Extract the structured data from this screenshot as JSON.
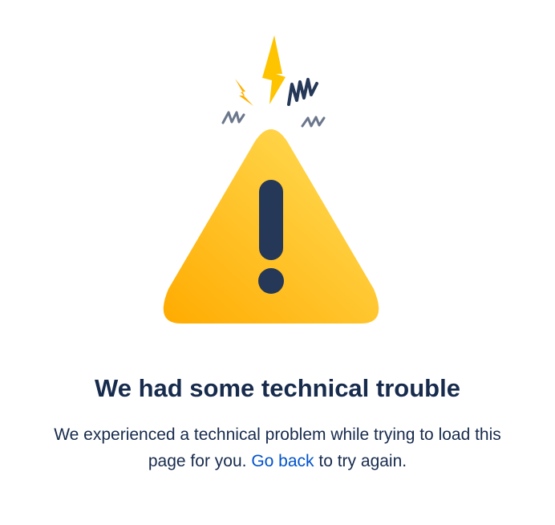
{
  "error": {
    "title": "We had some technical trouble",
    "message_before_link": "We experienced a technical problem while trying to load this page for you.",
    "link_label": "Go back",
    "message_after_link": "to try again."
  },
  "illustration": {
    "icon": "warning-triangle-icon",
    "triangle_colors": [
      "#ffab00",
      "#ffd740"
    ],
    "mark_color": "#253858",
    "bolt_color": "#ffc400",
    "squiggle_color": "#253858"
  },
  "colors": {
    "text": "#172b4d",
    "link": "#0052cc",
    "background": "#ffffff"
  }
}
